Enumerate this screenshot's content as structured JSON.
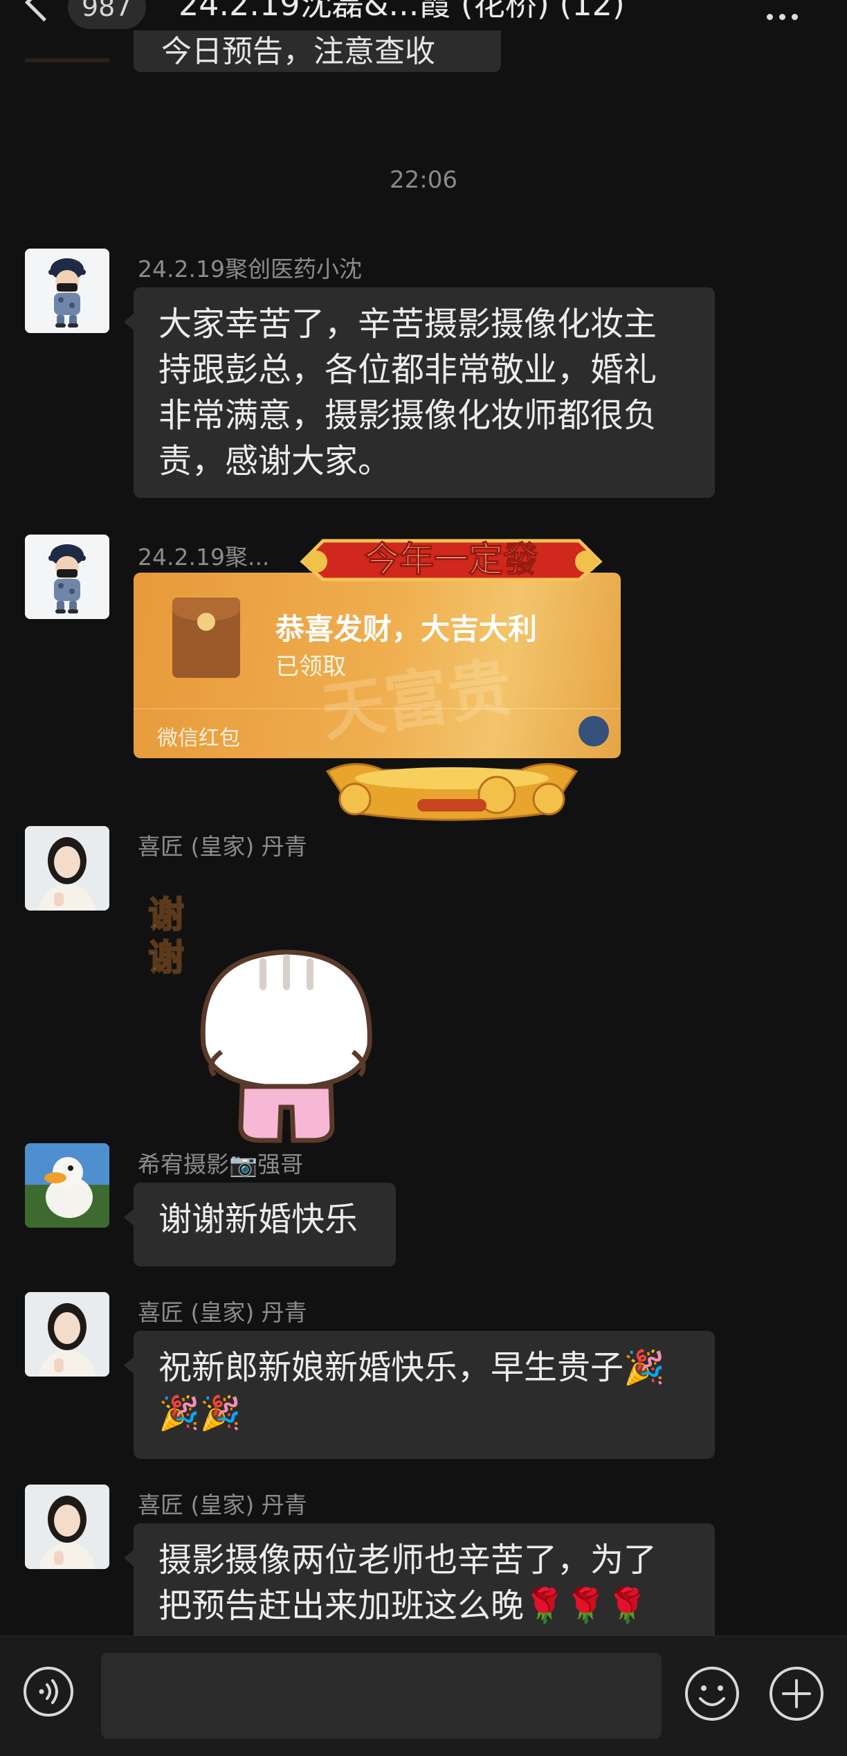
{
  "header": {
    "unread_count": "987",
    "title": "24.2.19沈磊&...霞 (花桥) (12)"
  },
  "chat": {
    "previous_message_fragment": "今日预告，注意查收",
    "timestamp": "22:06",
    "messages": [
      {
        "sender": "24.2.19聚创医药小沈",
        "avatar": "boy-cartoon-avatar",
        "type": "text",
        "lines": [
          "大家幸苦了，辛苦摄影摄像化妆主",
          "持跟彭总，各位都非常敬业，婚礼",
          "非常满意，摄影摄像化妆师都很负",
          "责，感谢大家。"
        ]
      },
      {
        "sender": "24.2.19聚...",
        "avatar": "boy-cartoon-avatar",
        "type": "red_packet",
        "banner": "今年一定發",
        "packet_title": "恭喜发财，大吉大利",
        "packet_status": "已领取",
        "packet_footer": "微信红包",
        "packet_bg_text": "天富贵"
      },
      {
        "sender": "喜匠 (皇家) 丹青",
        "avatar": "woman-avatar",
        "type": "sticker",
        "sticker_text": [
          "谢",
          "谢"
        ]
      },
      {
        "sender": "希宥摄影📷强哥",
        "avatar": "duck-avatar",
        "type": "text",
        "lines": [
          "谢谢新婚快乐"
        ]
      },
      {
        "sender": "喜匠 (皇家) 丹青",
        "avatar": "woman-avatar",
        "type": "text",
        "lines": [
          "祝新郎新娘新婚快乐，早生贵子🎉",
          "🎉🎉"
        ]
      },
      {
        "sender": "喜匠 (皇家) 丹青",
        "avatar": "woman-avatar",
        "type": "text",
        "lines": [
          "摄影摄像两位老师也辛苦了，为了",
          "把预告赶出来加班这么晚🌹🌹🌹"
        ]
      }
    ]
  },
  "colors": {
    "background": "#111111",
    "bubble": "#2c2c2c",
    "red_packet": "#efad4e",
    "name_text": "#8c8c8c"
  },
  "composer": {
    "voice_icon": "voice-icon",
    "emoji_icon": "emoji-icon",
    "plus_icon": "plus-icon"
  }
}
